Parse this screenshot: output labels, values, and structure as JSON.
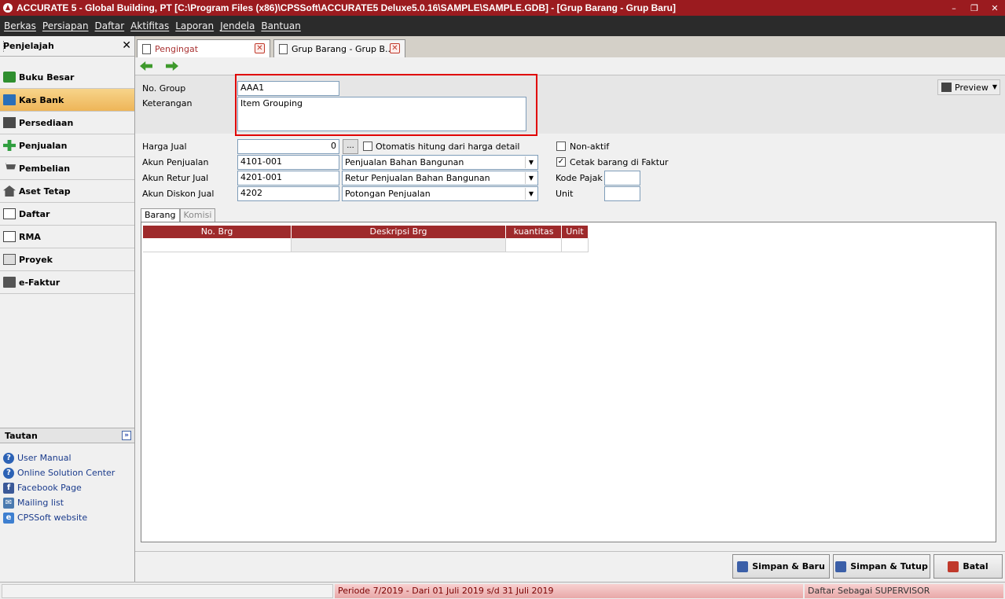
{
  "window": {
    "title": "ACCURATE 5  - Global Building, PT   [C:\\Program Files (x86)\\CPSSoft\\ACCURATE5 Deluxe5.0.16\\SAMPLE\\SAMPLE.GDB] - [Grup Barang - Grup Baru]",
    "minimize": "–",
    "restore": "❐",
    "close": "✕"
  },
  "menu": [
    "Berkas",
    "Persiapan",
    "Daftar",
    "Aktifitas",
    "Laporan",
    "Jendela",
    "Bantuan"
  ],
  "sidebar": {
    "title": "Penjelajah",
    "close": "✕",
    "items": [
      {
        "label": "Buku Besar",
        "icon": "ledger-icon"
      },
      {
        "label": "Kas Bank",
        "icon": "bank-icon"
      },
      {
        "label": "Persediaan",
        "icon": "inventory-icon"
      },
      {
        "label": "Penjualan",
        "icon": "sales-icon"
      },
      {
        "label": "Pembelian",
        "icon": "cart-icon"
      },
      {
        "label": "Aset Tetap",
        "icon": "house-icon"
      },
      {
        "label": "Daftar",
        "icon": "list-icon"
      },
      {
        "label": "RMA",
        "icon": "rma-icon"
      },
      {
        "label": "Proyek",
        "icon": "project-icon"
      },
      {
        "label": "e-Faktur",
        "icon": "efaktur-icon"
      }
    ],
    "active_index": 1,
    "tautan_title": "Tautan",
    "links": [
      {
        "label": "User Manual",
        "glyph": "?"
      },
      {
        "label": "Online Solution Center",
        "glyph": "?"
      },
      {
        "label": "Facebook Page",
        "glyph": "f"
      },
      {
        "label": "Mailing list",
        "glyph": "✉"
      },
      {
        "label": "CPSSoft website",
        "glyph": "e"
      }
    ]
  },
  "tabs": [
    {
      "label": "Pengingat"
    },
    {
      "label": "Grup Barang - Grup B..."
    }
  ],
  "form": {
    "no_group_label": "No. Group",
    "no_group_value": "AAA1",
    "keterangan_label": "Keterangan",
    "keterangan_value": "Item Grouping",
    "preview_label": "Preview",
    "harga_jual_label": "Harga Jual",
    "harga_jual_value": "0",
    "dots": "...",
    "otomatis_label": "Otomatis hitung dari harga detail",
    "otomatis_checked": false,
    "akun_penjualan_label": "Akun Penjualan",
    "akun_penjualan_code": "4101-001",
    "akun_penjualan_name": "Penjualan Bahan Bangunan",
    "akun_retur_label": "Akun Retur Jual",
    "akun_retur_code": "4201-001",
    "akun_retur_name": "Retur Penjualan Bahan Bangunan",
    "akun_diskon_label": "Akun Diskon Jual",
    "akun_diskon_code": "4202",
    "akun_diskon_name": "Potongan Penjualan",
    "non_aktif_label": "Non-aktif",
    "non_aktif_checked": false,
    "cetak_label": "Cetak barang di Faktur",
    "cetak_checked": true,
    "kode_pajak_label": "Kode Pajak",
    "unit_label": "Unit",
    "check_mark": "✓"
  },
  "subtabs": [
    "Barang",
    "Komisi"
  ],
  "grid": {
    "columns": [
      "No. Brg",
      "Deskripsi Brg",
      "kuantitas",
      "Unit"
    ]
  },
  "buttons": {
    "simpan_baru": "Simpan & Baru",
    "simpan_tutup": "Simpan & Tutup",
    "batal": "Batal"
  },
  "status": {
    "left": "",
    "periode": "Periode 7/2019 - Dari 01 Juli 2019 s/d 31 Juli 2019",
    "user": "Daftar Sebagai SUPERVISOR"
  },
  "colors": {
    "titlebar": "#9b1b1f",
    "grid_header": "#9e2a2b",
    "highlight_box": "#e00000",
    "active_item": "#eeb558"
  }
}
